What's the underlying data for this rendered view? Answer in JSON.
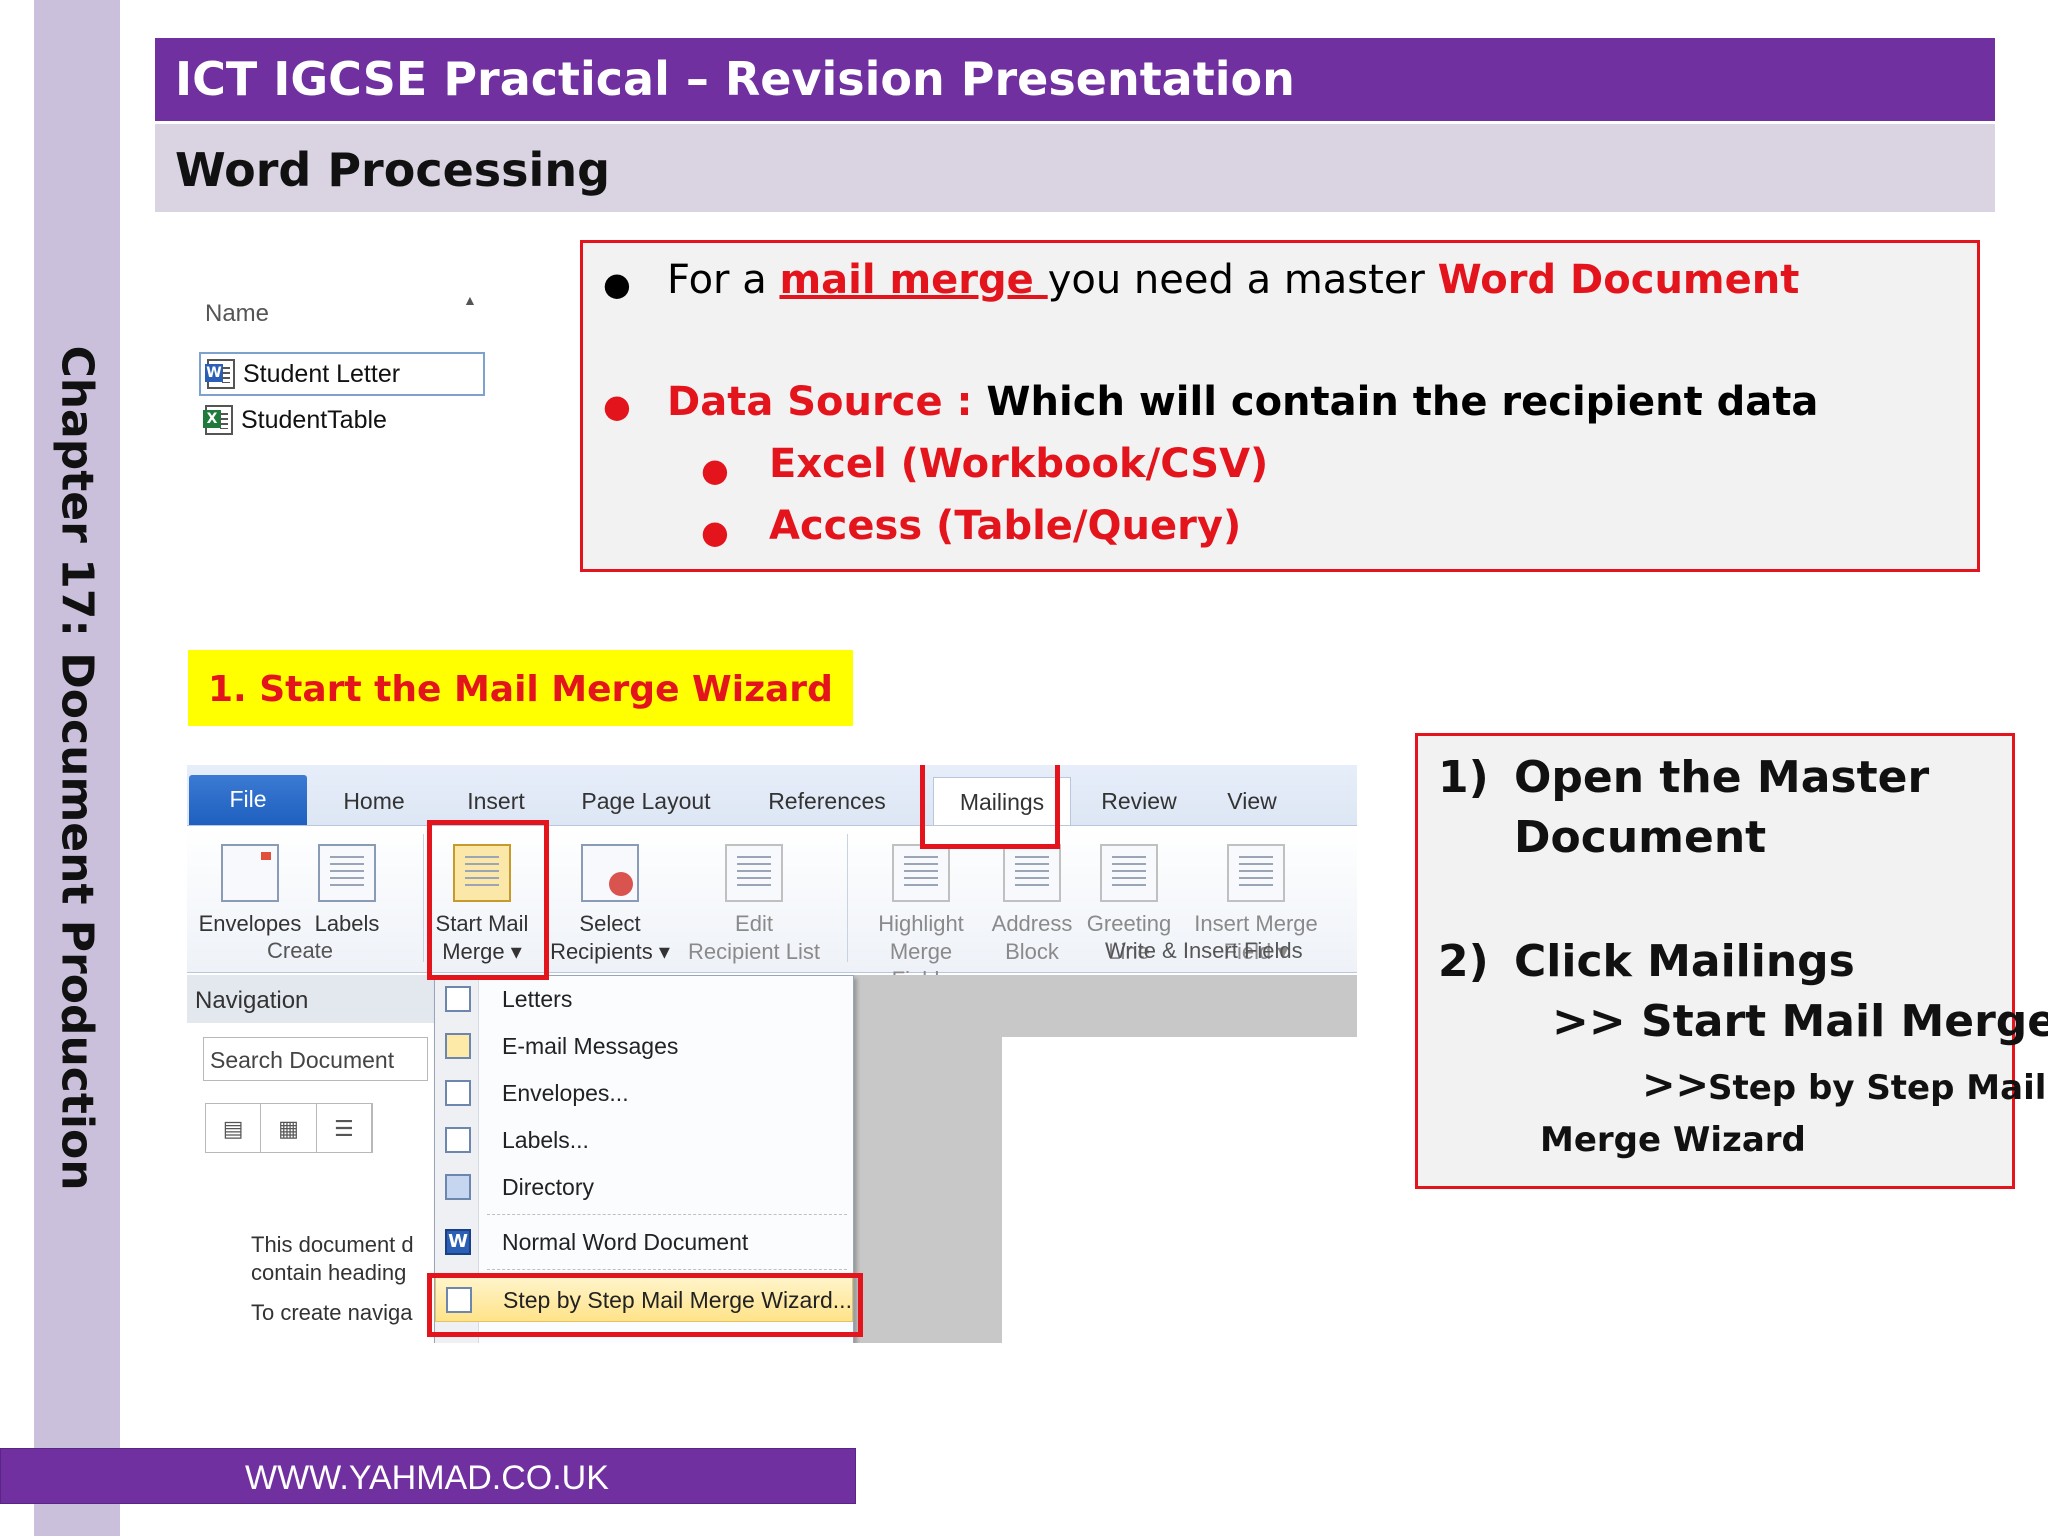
{
  "slide": {
    "title": "ICT IGCSE Practical – Revision Presentation",
    "subtitle": "Word Processing",
    "side_label": "Chapter 17: Document Production",
    "footer": "WWW.YAHMAD.CO.UK",
    "section_label": "1. Start the Mail Merge Wizard"
  },
  "file_list": {
    "header": "Name",
    "items": [
      {
        "name": "Student Letter",
        "icon": "word-file-icon",
        "selected": true
      },
      {
        "name": "StudentTable",
        "icon": "excel-file-icon",
        "selected": false
      }
    ]
  },
  "info": {
    "b1_pre": "For a ",
    "b1_link": "mail merge ",
    "b1_mid": "you need a master ",
    "b1_end": "Word Document",
    "b2_label": "Data Source : ",
    "b2_text": "Which will contain the recipient  data",
    "sub1": "Excel (Workbook/CSV)",
    "sub2": "Access (Table/Query)"
  },
  "word": {
    "tabs": [
      "File",
      "Home",
      "Insert",
      "Page Layout",
      "References",
      "Mailings",
      "Review",
      "View"
    ],
    "active_tab": "Mailings",
    "buttons": {
      "envelopes": "Envelopes",
      "labels": "Labels",
      "start_mail_1": "Start Mail",
      "start_mail_2": "Merge ▾",
      "select_1": "Select",
      "select_2": "Recipients ▾",
      "edit_1": "Edit",
      "edit_2": "Recipient List",
      "highlight_1": "Highlight",
      "highlight_2": "Merge Fields",
      "address_1": "Address",
      "address_2": "Block",
      "greeting_1": "Greeting",
      "greeting_2": "Line",
      "insert_1": "Insert Merge",
      "insert_2": "Field ▾"
    },
    "groups": {
      "create": "Create",
      "write_insert": "Write & Insert Fields"
    },
    "navigation": {
      "title": "Navigation",
      "search_placeholder": "Search Document",
      "text_1": "This document d",
      "text_2": "contain heading",
      "text_3": "To create naviga"
    },
    "menu": [
      {
        "label": "Letters",
        "icon": "letter-icon"
      },
      {
        "label": "E-mail Messages",
        "icon": "email-icon"
      },
      {
        "label": "Envelopes...",
        "icon": "envelope-icon"
      },
      {
        "label": "Labels...",
        "icon": "labels-icon"
      },
      {
        "label": "Directory",
        "icon": "directory-icon"
      },
      {
        "label": "Normal Word Document",
        "icon": "word-icon"
      },
      {
        "label": "Step by Step Mail Merge Wizard...",
        "icon": "wizard-icon"
      }
    ]
  },
  "steps": {
    "s1_num": "1)",
    "s1_line1": "Open the Master",
    "s1_line2": "Document",
    "s2_num": "2)",
    "s2_line1": "Click Mailings",
    "s2_line2": ">> Start Mail Merge",
    "s2_arrow": ">>",
    "s2_line3": "Step by Step Mail",
    "s2_line4": "Merge Wizard"
  },
  "colors": {
    "purple": "#7030a0",
    "lavender": "#d9d3e2",
    "red": "#e4141c",
    "yellow": "#ffff00"
  }
}
